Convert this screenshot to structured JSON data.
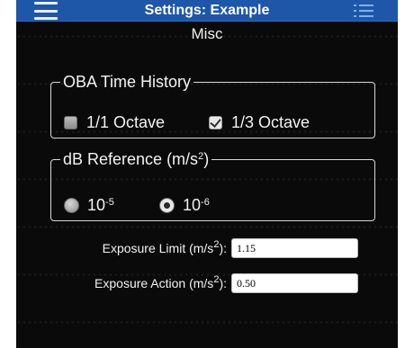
{
  "header": {
    "title": "Settings: Example",
    "subtitle": "Misc"
  },
  "icons": {
    "menu": "hamburger-menu-icon",
    "list": "list-icon"
  },
  "colors": {
    "header_bg": "#1e56a8",
    "screen_bg": "#0a0a0a",
    "text": "#f2f2f2"
  },
  "oba_group": {
    "legend": "OBA Time History",
    "options": [
      {
        "label": "1/1 Octave",
        "checked": false
      },
      {
        "label": "1/3 Octave",
        "checked": true
      }
    ]
  },
  "db_group": {
    "legend_prefix": "dB Reference (m/s",
    "legend_sup": "2",
    "legend_suffix": ")",
    "options": [
      {
        "base": "10",
        "exp": "-5",
        "selected": false
      },
      {
        "base": "10",
        "exp": "-6",
        "selected": true
      }
    ]
  },
  "fields": {
    "exposure_limit": {
      "label_prefix": "Exposure Limit (m/s",
      "label_sup": "2",
      "label_suffix": "):",
      "value": "1.15"
    },
    "exposure_action": {
      "label_prefix": "Exposure Action (m/s",
      "label_sup": "2",
      "label_suffix": "):",
      "value": "0.50"
    }
  }
}
